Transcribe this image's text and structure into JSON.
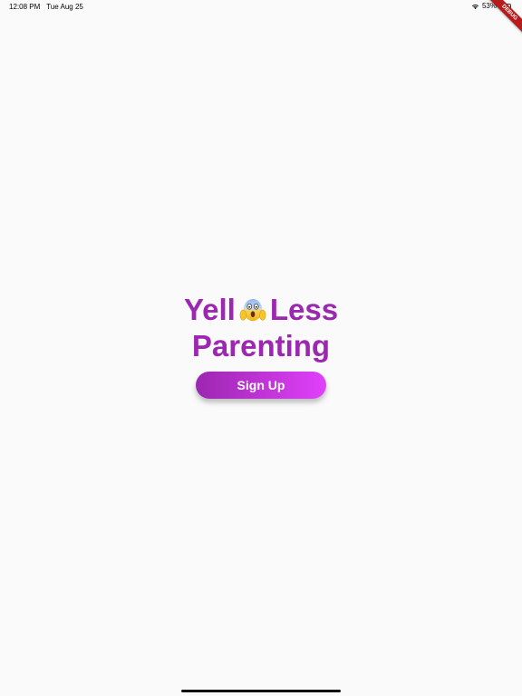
{
  "status_bar": {
    "time": "12:08 PM",
    "date": "Tue Aug 25",
    "battery_percent": "53%",
    "battery_level": 0.53
  },
  "debug_banner": {
    "label": "DEBUG"
  },
  "main": {
    "title_word_1": "Yell",
    "title_word_2": "Less",
    "title_line_2": "Parenting",
    "emoji_icon": "face-screaming-in-fear-icon",
    "signup_label": "Sign Up"
  },
  "colors": {
    "title": "#9c27b0",
    "button_gradient_start": "#9c27b0",
    "button_gradient_end": "#e040fb",
    "background": "#fafafa"
  }
}
